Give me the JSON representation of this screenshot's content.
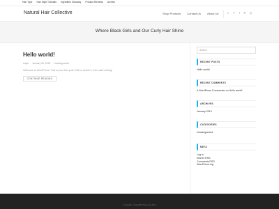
{
  "topnav": [
    "Hair Type",
    "Hair Style Tutorials",
    "Ingredient Glossary",
    "Product Reviews",
    "Archive"
  ],
  "site_title": "Natural Hair Collective",
  "mainnav": [
    "Shop Products",
    "Contact Us",
    "About Us"
  ],
  "header_icons": [
    "search-icon",
    "twitter-icon",
    "facebook-icon",
    "pinterest-icon",
    "instagram-icon"
  ],
  "hero_tagline": "Where Black Girls and Our Curly Hair Shine",
  "post": {
    "title": "Hello world!",
    "author": "Layla",
    "date": "January 26, 2019",
    "category": "Uncategorized",
    "excerpt": "Welcome to WordPress. This is your first post. Edit or delete it, then start writing!",
    "button": "CONTINUE READING"
  },
  "sidebar": {
    "search_placeholder": "Search",
    "recent_posts_title": "RECENT POSTS",
    "recent_posts": [
      "Hello world!"
    ],
    "recent_comments_title": "RECENT COMMENTS",
    "recent_comment": "A WordPress Commenter on Hello world!",
    "archives_title": "ARCHIVES",
    "archives": [
      "January 2019"
    ],
    "categories_title": "CATEGORIES",
    "categories": [
      "Uncategorized"
    ],
    "meta_title": "META",
    "meta_links": [
      "Log in",
      "Entries RSS",
      "Comments RSS",
      "WordPress.org"
    ]
  },
  "footer_copyright": "Copyright - OceanWP Theme by Nick",
  "accent_color": "#13aff0"
}
